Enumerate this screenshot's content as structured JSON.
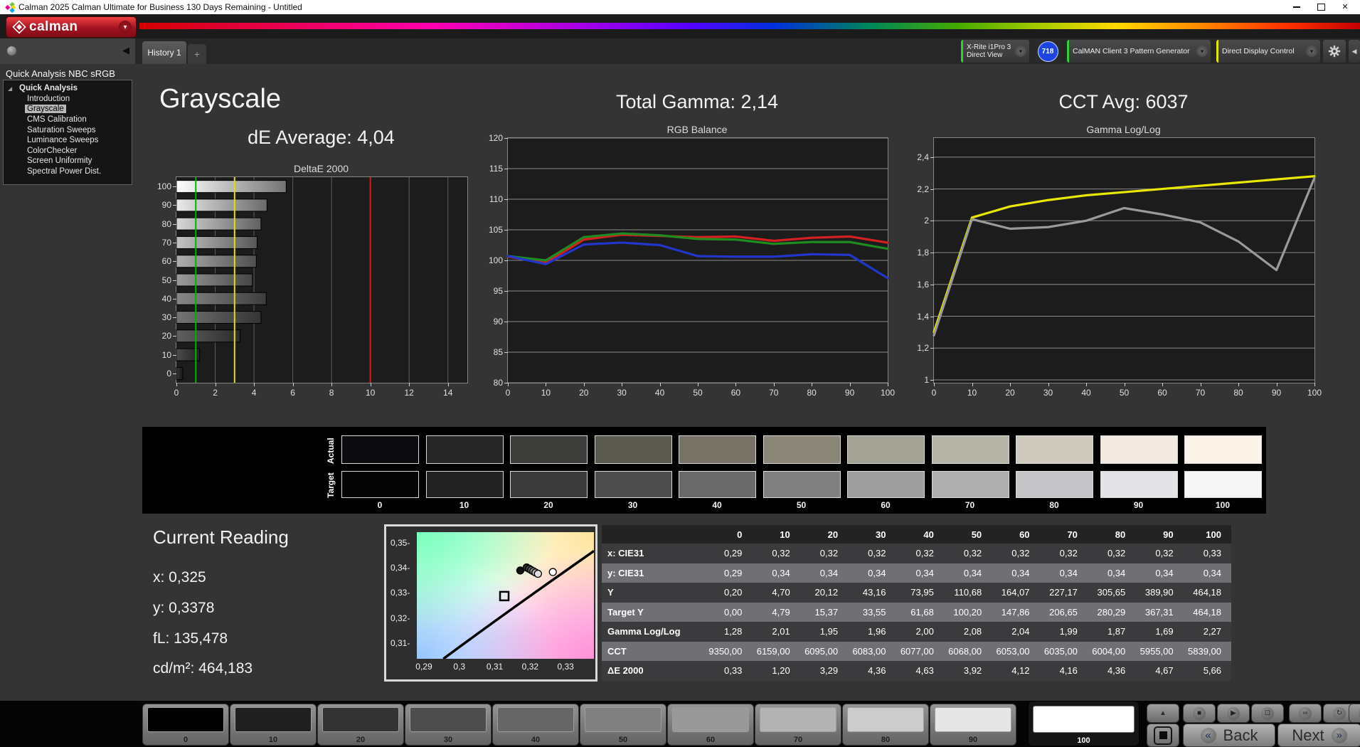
{
  "window": {
    "title": "Calman 2025 Calman Ultimate for Business 130 Days Remaining  - Untitled"
  },
  "brand": {
    "logo_label": "calman"
  },
  "tabs": {
    "active": "History 1",
    "add": "+"
  },
  "devices": {
    "meter": {
      "line1": "X-Rite i1Pro 3",
      "line2": "Direct View",
      "badge": "718",
      "accent_color": "#2fd133"
    },
    "pattern_generator": {
      "label": "CalMAN Client 3 Pattern Generator",
      "accent_color": "#2fd133"
    },
    "display_control": {
      "label": "Direct Display Control",
      "accent_color": "#e3e300"
    }
  },
  "icons": {
    "close": "✕",
    "dropdown": "▾",
    "collapse_left": "◀",
    "expander": "◢",
    "up": "▲",
    "back_chevrons": "«",
    "next_chevrons": "»"
  },
  "sidebar": {
    "title": "Quick Analysis NBC sRGB",
    "root": "Quick Analysis",
    "items": [
      "Introduction",
      "Grayscale",
      "CMS Calibration",
      "Saturation Sweeps",
      "Luminance Sweeps",
      "ColorChecker",
      "Screen Uniformity",
      "Spectral Power Dist."
    ],
    "selected": "Grayscale"
  },
  "headers": {
    "page_title": "Grayscale",
    "de_average": "dE Average: 4,04",
    "total_gamma": "Total Gamma: 2,14",
    "cct_avg": "CCT Avg: 6037"
  },
  "chart_data": [
    {
      "type": "bar",
      "orientation": "horizontal",
      "title": "DeltaE 2000",
      "categories": [
        0,
        10,
        20,
        30,
        40,
        50,
        60,
        70,
        80,
        90,
        100
      ],
      "values": [
        0.33,
        1.2,
        3.29,
        4.36,
        4.63,
        3.92,
        4.12,
        4.16,
        4.36,
        4.67,
        5.66
      ],
      "xlim": [
        0,
        15
      ],
      "x_ticks": [
        0,
        2,
        4,
        6,
        8,
        10,
        12,
        14
      ],
      "reference_lines": [
        {
          "value": 1,
          "color": "#00b400",
          "name": "good-limit"
        },
        {
          "value": 3,
          "color": "#e0e000",
          "name": "warning-limit"
        },
        {
          "value": 10,
          "color": "#d41a1a",
          "name": "error-limit"
        }
      ]
    },
    {
      "type": "line",
      "title": "RGB Balance",
      "x": [
        0,
        10,
        20,
        30,
        40,
        50,
        60,
        70,
        80,
        90,
        100
      ],
      "ylim": [
        80,
        120
      ],
      "y_ticks": [
        80,
        85,
        90,
        95,
        100,
        105,
        110,
        115,
        120
      ],
      "x_ticks": [
        0,
        10,
        20,
        30,
        40,
        50,
        60,
        70,
        80,
        90,
        100
      ],
      "series": [
        {
          "name": "Red",
          "color": "#d42020",
          "values": [
            100.6,
            99.6,
            103.4,
            104.2,
            104.0,
            103.8,
            103.9,
            103.2,
            103.7,
            103.9,
            102.9
          ]
        },
        {
          "name": "Green",
          "color": "#1f8c1f",
          "values": [
            100.7,
            100.0,
            103.8,
            104.4,
            104.1,
            103.5,
            103.4,
            102.7,
            103.0,
            103.0,
            101.9
          ]
        },
        {
          "name": "Blue",
          "color": "#2236cc",
          "values": [
            100.7,
            99.4,
            102.6,
            102.9,
            102.5,
            100.7,
            100.6,
            100.6,
            101.0,
            100.9,
            97.1
          ]
        }
      ]
    },
    {
      "type": "line",
      "title": "Gamma Log/Log",
      "x": [
        0,
        10,
        20,
        30,
        40,
        50,
        60,
        70,
        80,
        90,
        100
      ],
      "ylim": [
        0.982,
        2.52
      ],
      "y_tick_values": [
        1,
        1.2,
        1.4,
        1.6,
        1.8,
        2,
        2.2,
        2.4
      ],
      "y_tick_labels": [
        "1",
        "1,2",
        "1,4",
        "1,6",
        "1,8",
        "2",
        "2,2",
        "2,4"
      ],
      "x_ticks": [
        0,
        10,
        20,
        30,
        40,
        50,
        60,
        70,
        80,
        90,
        100
      ],
      "series": [
        {
          "name": "Target Gamma",
          "color": "#e8e800",
          "values": [
            1.3,
            2.02,
            2.09,
            2.13,
            2.16,
            2.18,
            2.2,
            2.22,
            2.24,
            2.26,
            2.28
          ]
        },
        {
          "name": "Measured Gamma",
          "color": "#9a9a9a",
          "values": [
            1.28,
            2.01,
            1.95,
            1.96,
            2.0,
            2.08,
            2.04,
            1.99,
            1.87,
            1.69,
            2.27
          ]
        }
      ]
    },
    {
      "type": "scatter",
      "title": "CIE 1931 chromaticity (zoom)",
      "xlim": [
        0.288,
        0.338
      ],
      "ylim": [
        0.304,
        0.3545
      ],
      "x_tick_values": [
        0.29,
        0.3,
        0.31,
        0.32,
        0.33
      ],
      "x_tick_labels": [
        "0,29",
        "0,3",
        "0,31",
        "0,32",
        "0,33"
      ],
      "y_tick_values": [
        0.35,
        0.34,
        0.33,
        0.32,
        0.31
      ],
      "y_tick_labels": [
        "0,35",
        "0,34",
        "0,33",
        "0,32",
        "0,31"
      ],
      "locus": [
        [
          0.2955,
          0.304
        ],
        [
          0.3125,
          0.3235
        ],
        [
          0.338,
          0.347
        ]
      ],
      "points": [
        {
          "x": 0.3172,
          "y": 0.3392,
          "fill": "#101010"
        },
        {
          "x": 0.319,
          "y": 0.3404,
          "fill": "#2e2e2e"
        },
        {
          "x": 0.3197,
          "y": 0.3399,
          "fill": "#4a4a4a"
        },
        {
          "x": 0.3203,
          "y": 0.3394,
          "fill": "#686868"
        },
        {
          "x": 0.3209,
          "y": 0.3389,
          "fill": "#8c8c8c"
        },
        {
          "x": 0.3215,
          "y": 0.3384,
          "fill": "#b2b2b2"
        },
        {
          "x": 0.3222,
          "y": 0.3379,
          "fill": "#e2e2e2"
        },
        {
          "x": 0.3264,
          "y": 0.3386,
          "fill": "#ffffff"
        }
      ],
      "target_point": {
        "x": 0.3127,
        "y": 0.329
      }
    }
  ],
  "swatches": {
    "row_labels": [
      "Actual",
      "Target"
    ],
    "levels": [
      "0",
      "10",
      "20",
      "30",
      "40",
      "50",
      "60",
      "70",
      "80",
      "90",
      "100"
    ],
    "actual_colors": [
      "#0b0b10",
      "#262626",
      "#3c3c3b",
      "#5a594f",
      "#777467",
      "#898577",
      "#a4a295",
      "#b5b3a5",
      "#cecabd",
      "#f2eae0",
      "#fdf4e9"
    ],
    "target_colors": [
      "#050505",
      "#232323",
      "#3a3a3a",
      "#4e4e4e",
      "#6a6a6a",
      "#808080",
      "#9e9e9e",
      "#aeaeae",
      "#c5c5c8",
      "#e4e4e6",
      "#f6f6f6"
    ]
  },
  "current_reading": {
    "title": "Current Reading",
    "x": "x: 0,325",
    "y": "y: 0,3378",
    "fl": "fL: 135,478",
    "cdm2": "cd/m²: 464,183"
  },
  "table": {
    "columns": [
      "0",
      "10",
      "20",
      "30",
      "40",
      "50",
      "60",
      "70",
      "80",
      "90",
      "100"
    ],
    "rows": [
      {
        "label": "x: CIE31",
        "values": [
          "0,29",
          "0,32",
          "0,32",
          "0,32",
          "0,32",
          "0,32",
          "0,32",
          "0,32",
          "0,32",
          "0,32",
          "0,33"
        ]
      },
      {
        "label": "y: CIE31",
        "values": [
          "0,29",
          "0,34",
          "0,34",
          "0,34",
          "0,34",
          "0,34",
          "0,34",
          "0,34",
          "0,34",
          "0,34",
          "0,34"
        ]
      },
      {
        "label": "Y",
        "values": [
          "0,20",
          "4,70",
          "20,12",
          "43,16",
          "73,95",
          "110,68",
          "164,07",
          "227,17",
          "305,65",
          "389,90",
          "464,18"
        ]
      },
      {
        "label": "Target Y",
        "values": [
          "0,00",
          "4,79",
          "15,37",
          "33,55",
          "61,68",
          "100,20",
          "147,86",
          "206,65",
          "280,29",
          "367,31",
          "464,18"
        ]
      },
      {
        "label": "Gamma Log/Log",
        "values": [
          "1,28",
          "2,01",
          "1,95",
          "1,96",
          "2,00",
          "2,08",
          "2,04",
          "1,99",
          "1,87",
          "1,69",
          "2,27"
        ]
      },
      {
        "label": "CCT",
        "values": [
          "9350,00",
          "6159,00",
          "6095,00",
          "6083,00",
          "6077,00",
          "6068,00",
          "6053,00",
          "6035,00",
          "6004,00",
          "5955,00",
          "5839,00"
        ]
      },
      {
        "label": "ΔE 2000",
        "values": [
          "0,33",
          "1,20",
          "3,29",
          "4,36",
          "4,63",
          "3,92",
          "4,12",
          "4,16",
          "4,36",
          "4,67",
          "5,66"
        ]
      }
    ]
  },
  "bottom": {
    "patterns": [
      {
        "label": "0",
        "color": "#000000"
      },
      {
        "label": "10",
        "color": "#1f1f1f"
      },
      {
        "label": "20",
        "color": "#333333"
      },
      {
        "label": "30",
        "color": "#4d4d4d"
      },
      {
        "label": "40",
        "color": "#666666"
      },
      {
        "label": "50",
        "color": "#808080"
      },
      {
        "label": "60",
        "color": "#999999"
      },
      {
        "label": "70",
        "color": "#b3b3b3"
      },
      {
        "label": "80",
        "color": "#cccccc"
      },
      {
        "label": "90",
        "color": "#e6e6e6"
      },
      {
        "label": "100",
        "color": "#ffffff",
        "selected": true
      }
    ],
    "transport": [
      {
        "name": "stop",
        "glyph": "■"
      },
      {
        "name": "play",
        "glyph": "▶"
      },
      {
        "name": "pattern-window",
        "glyph": "⊡"
      },
      {
        "name": "loop",
        "glyph": "∞"
      },
      {
        "name": "refresh",
        "glyph": "↻"
      },
      {
        "name": "record",
        "glyph": ""
      }
    ],
    "nav": {
      "back": "Back",
      "next": "Next"
    }
  }
}
